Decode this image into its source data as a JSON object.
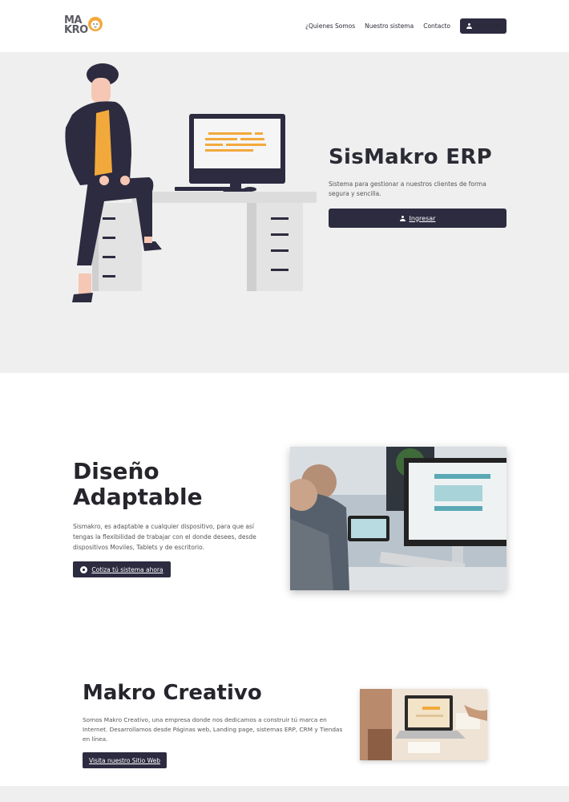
{
  "brand": {
    "line1": "MA",
    "line2": "KRO"
  },
  "nav": {
    "links": [
      "¿Quienes Somos",
      "Nuestro sistema",
      "Contacto"
    ],
    "login_label": "Ingresar"
  },
  "hero": {
    "title": "SisMakro ERP",
    "description": "Sistema para gestionar a nuestros clientes de forma segura y sencilla.",
    "button_label": "Ingresar"
  },
  "adaptive": {
    "title": "Diseño Adaptable",
    "description": "Sismakro, es adaptable a cualquier dispositivo, para que así tengas la flexibilidad de trabajar con el donde desees, desde dispositivos Moviles, Tablets y de escritorio.",
    "button_label": "Cotiza tú sistema ahora"
  },
  "creativo": {
    "title": "Makro Creativo",
    "description": "Somos Makro Creativo, una empresa donde nos dedicamos a construir tú marca en Internet. Desarrollamos desde Páginas web, Landing page, sistemas ERP, CRM y Tiendas en línea.",
    "button_label": "Visita nuestro Sitio Web"
  },
  "colors": {
    "primary": "#2c2b40",
    "accent": "#f2a93b",
    "hero_bg": "#efefef"
  }
}
